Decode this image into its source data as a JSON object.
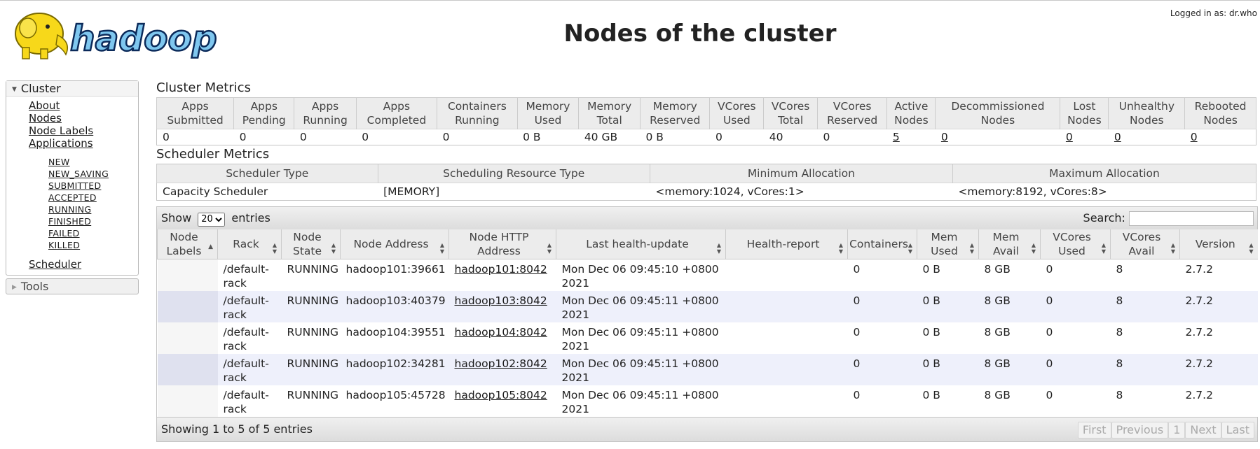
{
  "header": {
    "logo_alt": "hadoop",
    "title": "Nodes of the cluster",
    "logged_in": "Logged in as: dr.who"
  },
  "nav": {
    "cluster_label": "Cluster",
    "items": [
      "About",
      "Nodes",
      "Node Labels",
      "Applications"
    ],
    "app_states": [
      "NEW",
      "NEW_SAVING",
      "SUBMITTED",
      "ACCEPTED",
      "RUNNING",
      "FINISHED",
      "FAILED",
      "KILLED"
    ],
    "scheduler": "Scheduler",
    "tools_label": "Tools"
  },
  "cluster_metrics": {
    "title": "Cluster Metrics",
    "headers": [
      [
        "Apps",
        "Submitted"
      ],
      [
        "Apps",
        "Pending"
      ],
      [
        "Apps",
        "Running"
      ],
      [
        "Apps",
        "Completed"
      ],
      [
        "Containers",
        "Running"
      ],
      [
        "Memory",
        "Used"
      ],
      [
        "Memory",
        "Total"
      ],
      [
        "Memory",
        "Reserved"
      ],
      [
        "VCores",
        "Used"
      ],
      [
        "VCores",
        "Total"
      ],
      [
        "VCores",
        "Reserved"
      ],
      [
        "Active",
        "Nodes"
      ],
      [
        "Decommissioned",
        "Nodes"
      ],
      [
        "Lost",
        "Nodes"
      ],
      [
        "Unhealthy",
        "Nodes"
      ],
      [
        "Rebooted",
        "Nodes"
      ]
    ],
    "values": [
      "0",
      "0",
      "0",
      "0",
      "0",
      "0 B",
      "40 GB",
      "0 B",
      "0",
      "40",
      "0",
      "5",
      "0",
      "0",
      "0",
      "0"
    ]
  },
  "scheduler_metrics": {
    "title": "Scheduler Metrics",
    "headers": [
      "Scheduler Type",
      "Scheduling Resource Type",
      "Minimum Allocation",
      "Maximum Allocation"
    ],
    "values": [
      "Capacity Scheduler",
      "[MEMORY]",
      "<memory:1024, vCores:1>",
      "<memory:8192, vCores:8>"
    ]
  },
  "table": {
    "show_label": "Show",
    "entries_value": "20",
    "entries_label": "entries",
    "search_label": "Search:",
    "headers": [
      [
        "Node",
        "Labels"
      ],
      [
        "Rack",
        ""
      ],
      [
        "Node",
        "State"
      ],
      [
        "Node Address",
        ""
      ],
      [
        "Node HTTP",
        "Address"
      ],
      [
        "Last health-update",
        ""
      ],
      [
        "Health-report",
        ""
      ],
      [
        "Containers",
        ""
      ],
      [
        "Mem",
        "Used"
      ],
      [
        "Mem",
        "Avail"
      ],
      [
        "VCores",
        "Used"
      ],
      [
        "VCores",
        "Avail"
      ],
      [
        "Version",
        ""
      ]
    ],
    "rows": [
      {
        "rack": "/default-rack",
        "state": "RUNNING",
        "addr": "hadoop101:39661",
        "http": "hadoop101:8042",
        "health": "Mon Dec 06 09:45:10 +0800 2021",
        "report": "",
        "containers": "0",
        "mem_used": "0 B",
        "mem_avail": "8 GB",
        "vc_used": "0",
        "vc_avail": "8",
        "version": "2.7.2"
      },
      {
        "rack": "/default-rack",
        "state": "RUNNING",
        "addr": "hadoop103:40379",
        "http": "hadoop103:8042",
        "health": "Mon Dec 06 09:45:11 +0800 2021",
        "report": "",
        "containers": "0",
        "mem_used": "0 B",
        "mem_avail": "8 GB",
        "vc_used": "0",
        "vc_avail": "8",
        "version": "2.7.2"
      },
      {
        "rack": "/default-rack",
        "state": "RUNNING",
        "addr": "hadoop104:39551",
        "http": "hadoop104:8042",
        "health": "Mon Dec 06 09:45:11 +0800 2021",
        "report": "",
        "containers": "0",
        "mem_used": "0 B",
        "mem_avail": "8 GB",
        "vc_used": "0",
        "vc_avail": "8",
        "version": "2.7.2"
      },
      {
        "rack": "/default-rack",
        "state": "RUNNING",
        "addr": "hadoop102:34281",
        "http": "hadoop102:8042",
        "health": "Mon Dec 06 09:45:11 +0800 2021",
        "report": "",
        "containers": "0",
        "mem_used": "0 B",
        "mem_avail": "8 GB",
        "vc_used": "0",
        "vc_avail": "8",
        "version": "2.7.2"
      },
      {
        "rack": "/default-rack",
        "state": "RUNNING",
        "addr": "hadoop105:45728",
        "http": "hadoop105:8042",
        "health": "Mon Dec 06 09:45:11 +0800 2021",
        "report": "",
        "containers": "0",
        "mem_used": "0 B",
        "mem_avail": "8 GB",
        "vc_used": "0",
        "vc_avail": "8",
        "version": "2.7.2"
      }
    ],
    "info": "Showing 1 to 5 of 5 entries",
    "pager": [
      "First",
      "Previous",
      "1",
      "Next",
      "Last"
    ]
  }
}
